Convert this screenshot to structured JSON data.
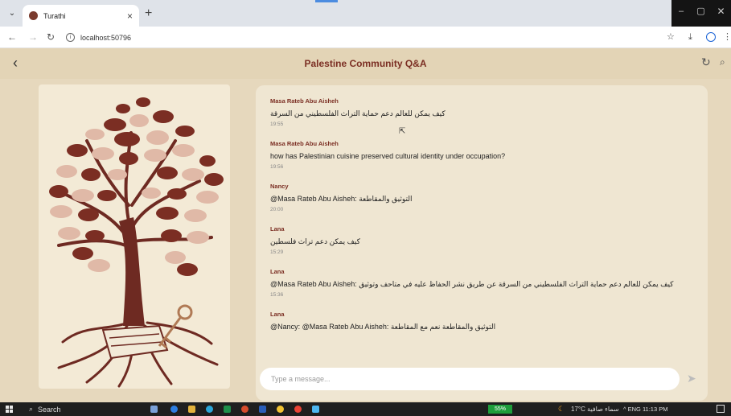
{
  "browser": {
    "tab_title": "Turathi",
    "tab_close": "×",
    "new_tab": "+",
    "url": "localhost:50796",
    "win_min": "–",
    "win_max": "▢",
    "win_close": "✕"
  },
  "app": {
    "title": "Palestine Community Q&A",
    "composer_placeholder": "Type a message..."
  },
  "messages": [
    {
      "sender": "Masa Rateb Abu Aisheh",
      "text": "كيف يمكن للعالم دعم حماية التراث الفلسطيني من السرقة",
      "time": "19:55"
    },
    {
      "sender": "Masa Rateb Abu Aisheh",
      "text": "how has Palestinian cuisine preserved cultural identity under occupation?",
      "time": "19:56"
    },
    {
      "sender": "Nancy",
      "text": "@Masa Rateb Abu Aisheh:  التوثيق والمقاطعة",
      "time": "20:00"
    },
    {
      "sender": "Lana",
      "text": "كيف يمكن دعم تراث فلسطين",
      "time": "15:29"
    },
    {
      "sender": "Lana",
      "text": "@Masa Rateb Abu Aisheh: كيف يمكن للعالم دعم حماية التراث الفلسطيني من السرقة   عن طريق نشر الحفاظ عليه في متاحف وتوثيق",
      "time": "15:36"
    },
    {
      "sender": "Lana",
      "text": "@Nancy: @Masa Rateb Abu Aisheh:  التوثيق والمقاطعة   نعم مع المقاطعة",
      "time": ""
    }
  ],
  "taskbar": {
    "search_label": "Search",
    "battery": "55%",
    "weather": "17°C  سماء صافية",
    "tray": "^  ENG  11:13 PM"
  },
  "colors": {
    "accent": "#7b2e23",
    "app_bg": "#e6d8bd",
    "chat_bg": "#efe6d2"
  }
}
